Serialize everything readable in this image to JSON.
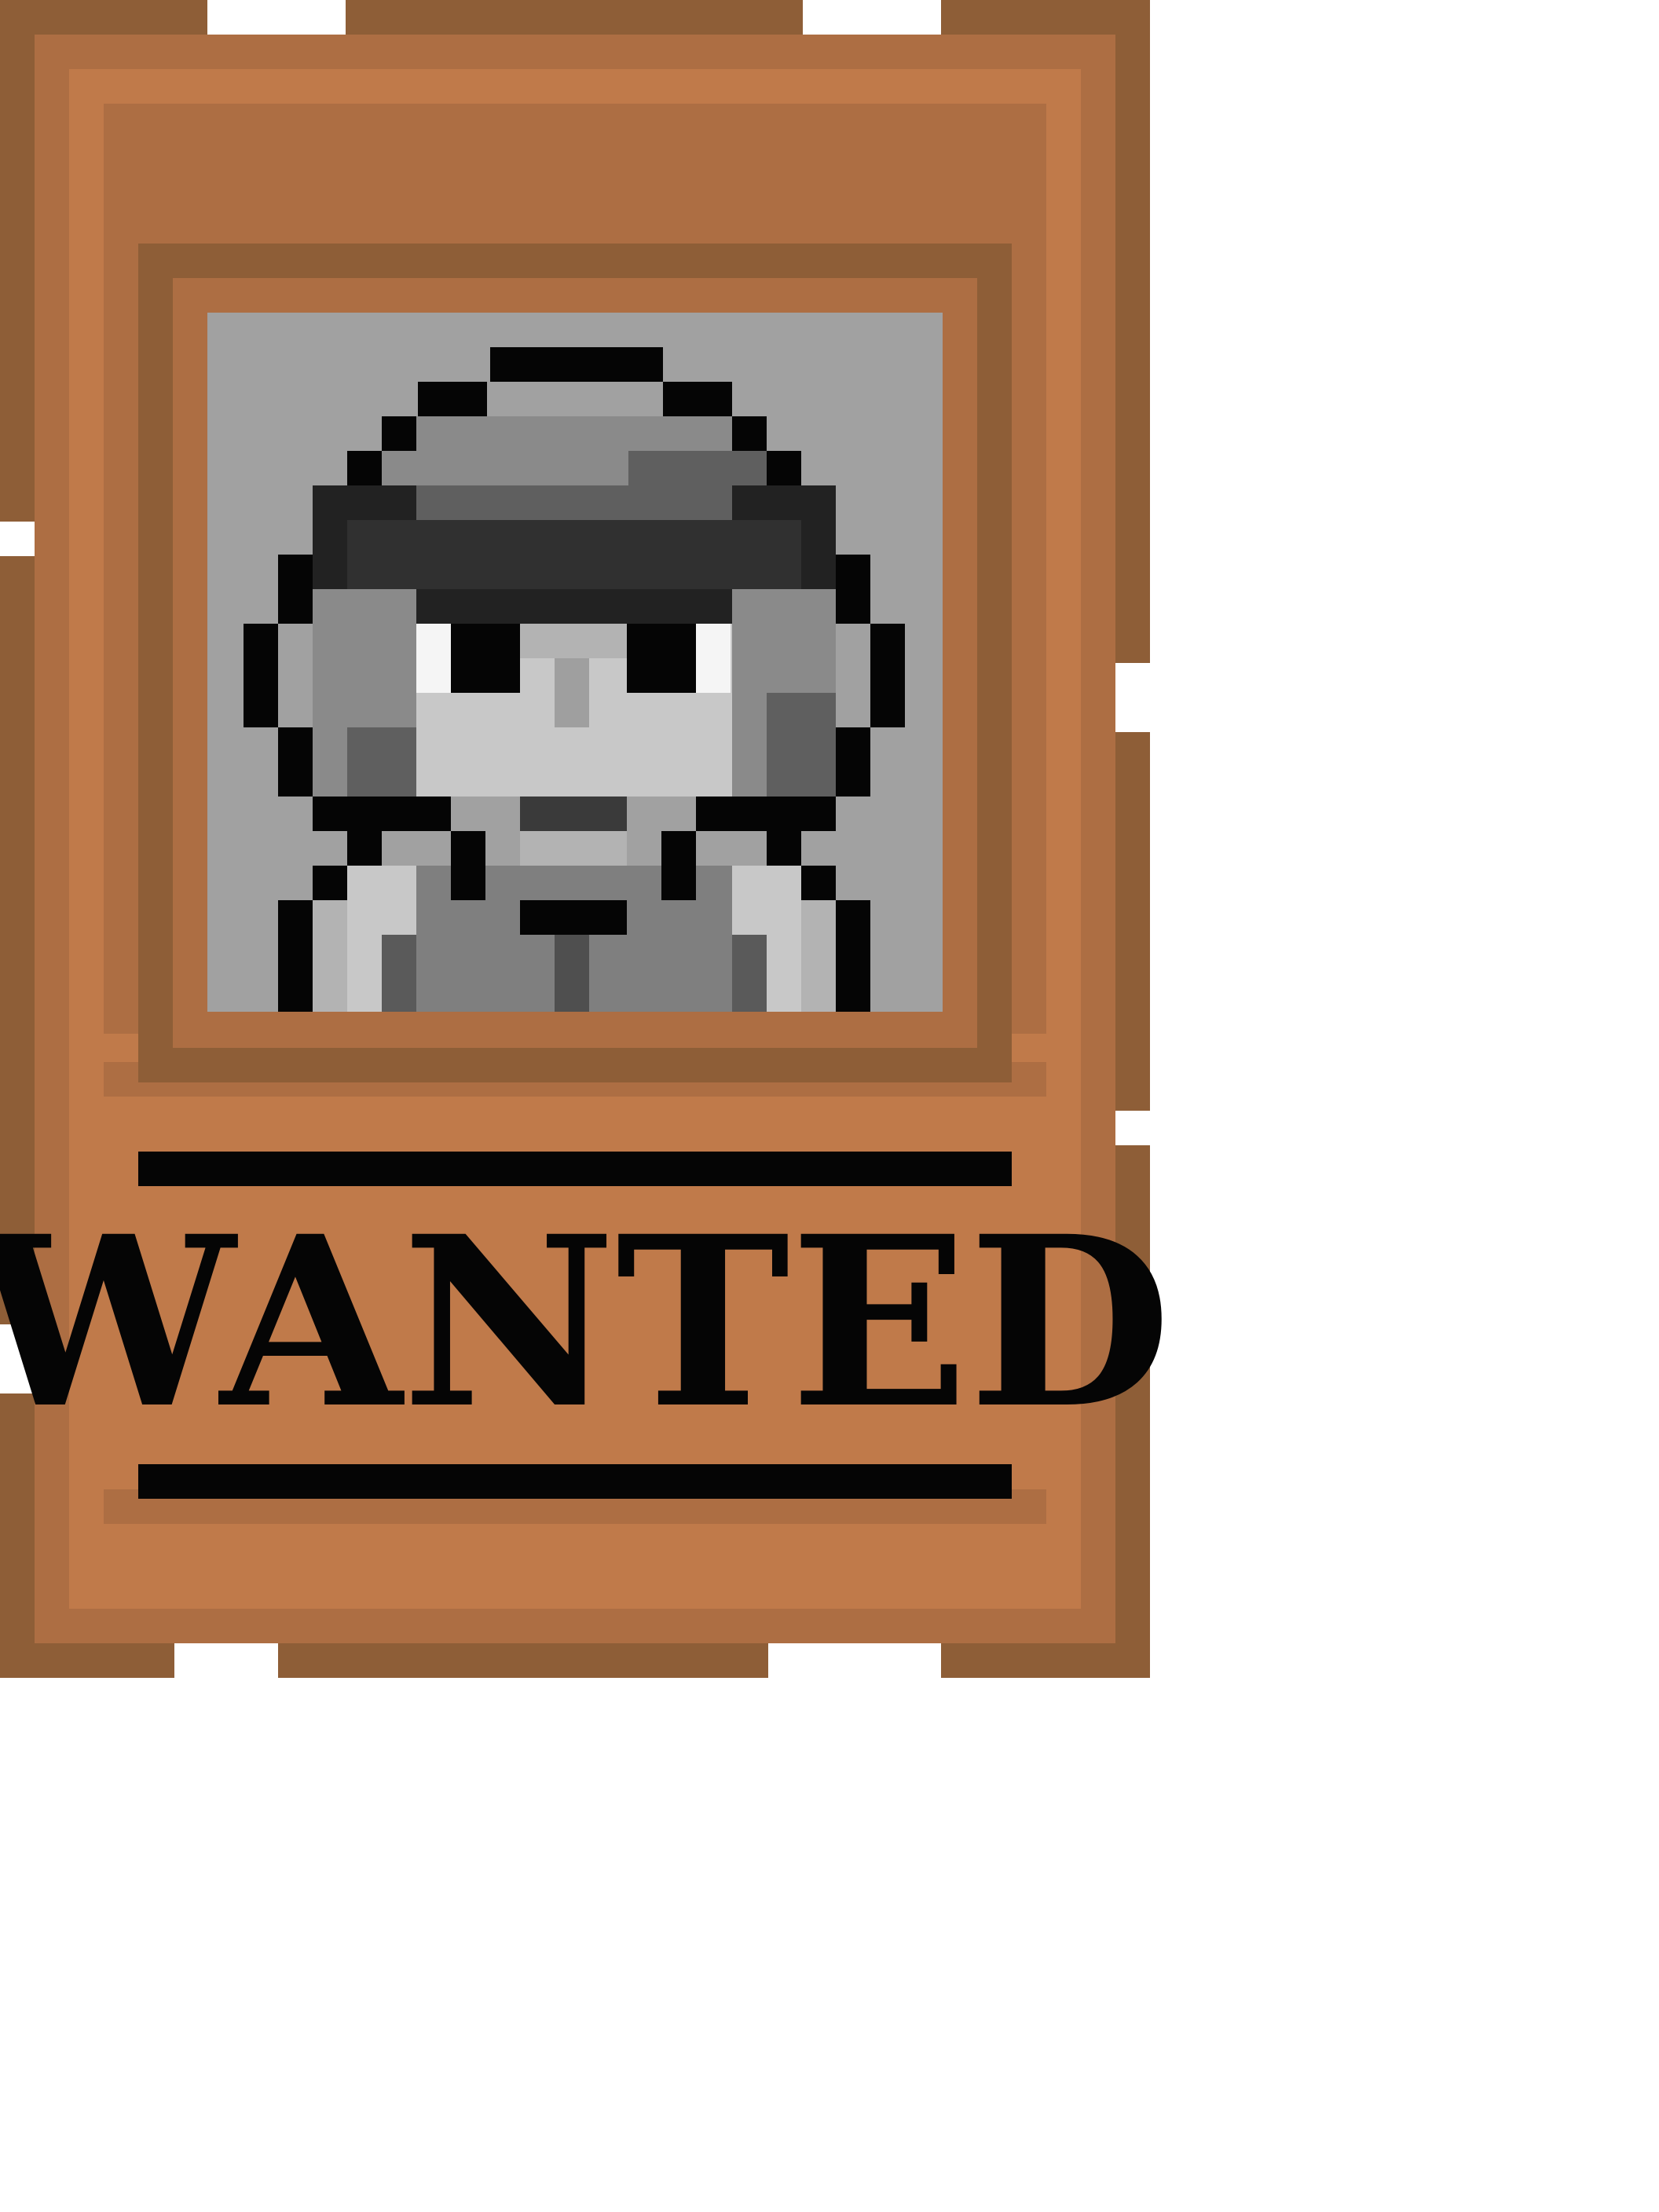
{
  "poster": {
    "heading": "WANTED"
  },
  "portrait": {
    "icon": "bandit-portrait-icon"
  },
  "colors": {
    "frame_dark": "#8e5e37",
    "frame_mid": "#ad6e43",
    "frame_light": "#c07a4a",
    "photo_bg": "#a1a1a1",
    "ink": "#050505",
    "white": "#ffffff"
  }
}
